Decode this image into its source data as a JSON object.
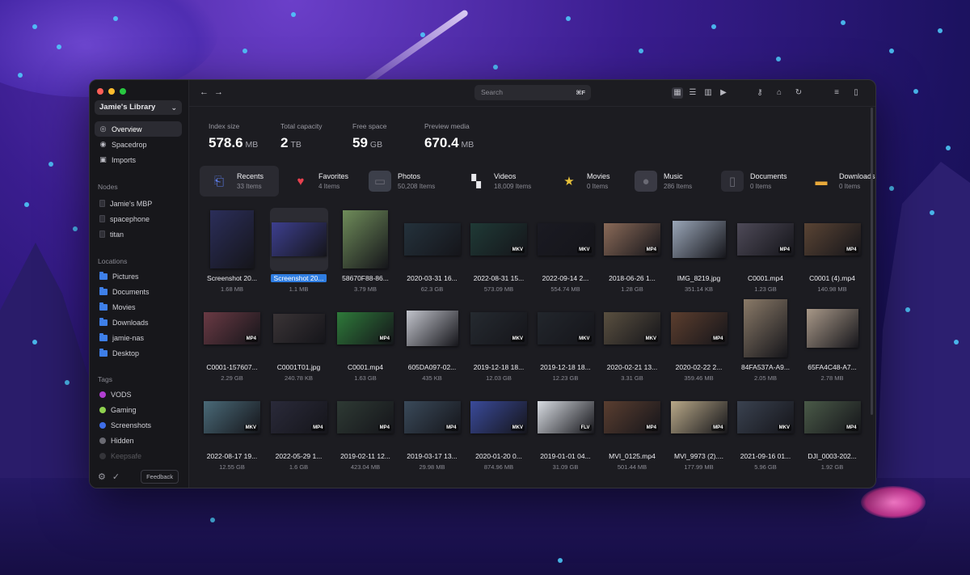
{
  "window": {
    "library": "Jamie's Library"
  },
  "sidebar": {
    "nav": [
      {
        "label": "Overview",
        "icon": "overview-icon"
      },
      {
        "label": "Spacedrop",
        "icon": "spacedrop-icon"
      },
      {
        "label": "Imports",
        "icon": "imports-icon"
      }
    ],
    "nodes_title": "Nodes",
    "nodes": [
      {
        "label": "Jamie's MBP"
      },
      {
        "label": "spacephone"
      },
      {
        "label": "titan"
      }
    ],
    "locations_title": "Locations",
    "locations": [
      {
        "label": "Pictures"
      },
      {
        "label": "Documents"
      },
      {
        "label": "Movies"
      },
      {
        "label": "Downloads"
      },
      {
        "label": "jamie-nas"
      },
      {
        "label": "Desktop"
      }
    ],
    "tags_title": "Tags",
    "tags": [
      {
        "label": "VODS",
        "color": "#b13fd1"
      },
      {
        "label": "Gaming",
        "color": "#8fd14f"
      },
      {
        "label": "Screenshots",
        "color": "#3f6ee8"
      },
      {
        "label": "Hidden",
        "color": "#6a6a72"
      },
      {
        "label": "Keepsafe",
        "color": "#6a6a72"
      }
    ],
    "feedback": "Feedback"
  },
  "toolbar": {
    "search_placeholder": "Search",
    "search_shortcut": "⌘F"
  },
  "stats": [
    {
      "label": "Index size",
      "value": "578.6",
      "unit": "MB"
    },
    {
      "label": "Total capacity",
      "value": "2",
      "unit": "TB"
    },
    {
      "label": "Free space",
      "value": "59",
      "unit": "GB"
    },
    {
      "label": "Preview media",
      "value": "670.4",
      "unit": "MB"
    }
  ],
  "categories": [
    {
      "name": "Recents",
      "count": "33 Items",
      "icon": "recents-icon",
      "color": "#5b7be8"
    },
    {
      "name": "Favorites",
      "count": "4 Items",
      "icon": "heart-icon",
      "color": "#e8414f"
    },
    {
      "name": "Photos",
      "count": "50,208 Items",
      "icon": "photos-icon",
      "color": "#3c3f4a"
    },
    {
      "name": "Videos",
      "count": "18,009 Items",
      "icon": "clapper-icon",
      "color": "#e8e8ec"
    },
    {
      "name": "Movies",
      "count": "0 Items",
      "icon": "movies-icon",
      "color": "#e8c23a"
    },
    {
      "name": "Music",
      "count": "286 Items",
      "icon": "music-icon",
      "color": "#3a3a44"
    },
    {
      "name": "Documents",
      "count": "0 Items",
      "icon": "document-icon",
      "color": "#2c2c34"
    },
    {
      "name": "Downloads",
      "count": "0 Items",
      "icon": "downloads-icon",
      "color": "#e8a93a"
    }
  ],
  "files": [
    {
      "name": "Screenshot 20...",
      "size": "1.68 MB",
      "badge": "",
      "color": "#2b2e5a",
      "w": 54,
      "h": 72
    },
    {
      "name": "Screenshot 20...",
      "size": "1.1 MB",
      "badge": "",
      "color": "#3d3f8f",
      "w": 68,
      "h": 42,
      "selected": true
    },
    {
      "name": "58670F88-86...",
      "size": "3.79 MB",
      "badge": "",
      "color": "#6f8c5a",
      "w": 56,
      "h": 72
    },
    {
      "name": "2020-03-31 16...",
      "size": "62.3 GB",
      "badge": "",
      "color": "#24323c",
      "w": 70,
      "h": 40
    },
    {
      "name": "2022-08-31 15...",
      "size": "573.09 MB",
      "badge": "MKV",
      "color": "#1f3a36",
      "w": 70,
      "h": 40
    },
    {
      "name": "2022-09-14 2...",
      "size": "554.74 MB",
      "badge": "MKV",
      "color": "#1a1a22",
      "w": 70,
      "h": 40
    },
    {
      "name": "2018-06-26 1...",
      "size": "1.28 GB",
      "badge": "MP4",
      "color": "#8a6a58",
      "w": 70,
      "h": 40
    },
    {
      "name": "IMG_8219.jpg",
      "size": "351.14 KB",
      "badge": "",
      "color": "#9aa6b8",
      "w": 66,
      "h": 46
    },
    {
      "name": "C0001.mp4",
      "size": "1.23 GB",
      "badge": "MP4",
      "color": "#4e4a58",
      "w": 70,
      "h": 40
    },
    {
      "name": "C0001 (4).mp4",
      "size": "140.98 MB",
      "badge": "MP4",
      "color": "#5a4434",
      "w": 70,
      "h": 40
    },
    {
      "name": "C0001-157607...",
      "size": "2.29 GB",
      "badge": "MP4",
      "color": "#6a3a44",
      "w": 70,
      "h": 40
    },
    {
      "name": "C0001T01.jpg",
      "size": "240.78 KB",
      "badge": "",
      "color": "#3a3436",
      "w": 64,
      "h": 36
    },
    {
      "name": "C0001.mp4",
      "size": "1.63 GB",
      "badge": "MP4",
      "color": "#2e7a3a",
      "w": 70,
      "h": 40
    },
    {
      "name": "605DA097-02...",
      "size": "435 KB",
      "badge": "",
      "color": "#c2c4cc",
      "w": 64,
      "h": 44
    },
    {
      "name": "2019-12-18 18...",
      "size": "12.03 GB",
      "badge": "MKV",
      "color": "#252a30",
      "w": 70,
      "h": 40
    },
    {
      "name": "2019-12-18 18...",
      "size": "12.23 GB",
      "badge": "MKV",
      "color": "#22262c",
      "w": 70,
      "h": 40
    },
    {
      "name": "2020-02-21 13...",
      "size": "3.31 GB",
      "badge": "MKV",
      "color": "#5a5040",
      "w": 70,
      "h": 40
    },
    {
      "name": "2020-02-22 2...",
      "size": "359.46 MB",
      "badge": "MP4",
      "color": "#5c3e2e",
      "w": 70,
      "h": 40
    },
    {
      "name": "84FA537A-A9...",
      "size": "2.05 MB",
      "badge": "",
      "color": "#8a7a68",
      "w": 54,
      "h": 72
    },
    {
      "name": "65FA4C48-A7...",
      "size": "2.78 MB",
      "badge": "",
      "color": "#a89888",
      "w": 64,
      "h": 48
    },
    {
      "name": "2022-08-17 19...",
      "size": "12.55 GB",
      "badge": "MKV",
      "color": "#4a6a78",
      "w": 70,
      "h": 40
    },
    {
      "name": "2022-05-29 1...",
      "size": "1.6 GB",
      "badge": "MP4",
      "color": "#2a2a3a",
      "w": 70,
      "h": 40
    },
    {
      "name": "2019-02-11 12...",
      "size": "423.04 MB",
      "badge": "MP4",
      "color": "#2e3a34",
      "w": 70,
      "h": 40
    },
    {
      "name": "2019-03-17 13...",
      "size": "29.98 MB",
      "badge": "MP4",
      "color": "#3a4a5a",
      "w": 70,
      "h": 40
    },
    {
      "name": "2020-01-20 0...",
      "size": "874.96 MB",
      "badge": "MKV",
      "color": "#3a4a9a",
      "w": 70,
      "h": 40
    },
    {
      "name": "2019-01-01 04...",
      "size": "31.09 GB",
      "badge": "FLV",
      "color": "#d8dce2",
      "w": 70,
      "h": 40
    },
    {
      "name": "MVI_0125.mp4",
      "size": "501.44 MB",
      "badge": "MP4",
      "color": "#5a3e30",
      "w": 70,
      "h": 40
    },
    {
      "name": "MVI_9973 (2)....",
      "size": "177.99 MB",
      "badge": "MP4",
      "color": "#b8a888",
      "w": 70,
      "h": 40
    },
    {
      "name": "2021-09-16 01...",
      "size": "5.96 GB",
      "badge": "MKV",
      "color": "#3a4250",
      "w": 70,
      "h": 40
    },
    {
      "name": "DJI_0003-202...",
      "size": "1.92 GB",
      "badge": "MP4",
      "color": "#4a5a48",
      "w": 70,
      "h": 40
    }
  ]
}
